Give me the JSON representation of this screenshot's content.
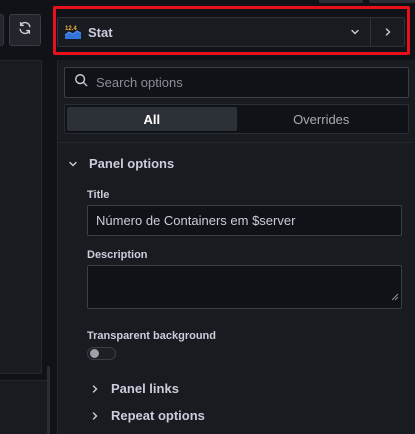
{
  "viz_picker": {
    "icon_text": "12.4",
    "name": "Stat"
  },
  "search": {
    "placeholder": "Search options"
  },
  "view_toggle": {
    "all_label": "All",
    "overrides_label": "Overrides",
    "selected": "All"
  },
  "panel_options": {
    "header": "Panel options",
    "title_label": "Title",
    "title_value": "Número de Containers em $server",
    "description_label": "Description",
    "description_value": "",
    "transparent_label": "Transparent background",
    "transparent_on": false
  },
  "sections": {
    "panel_links": "Panel links",
    "repeat_options": "Repeat options"
  },
  "colors": {
    "highlight": "#e8101b",
    "panel_bg": "#181b1f",
    "page_bg": "#111217"
  }
}
